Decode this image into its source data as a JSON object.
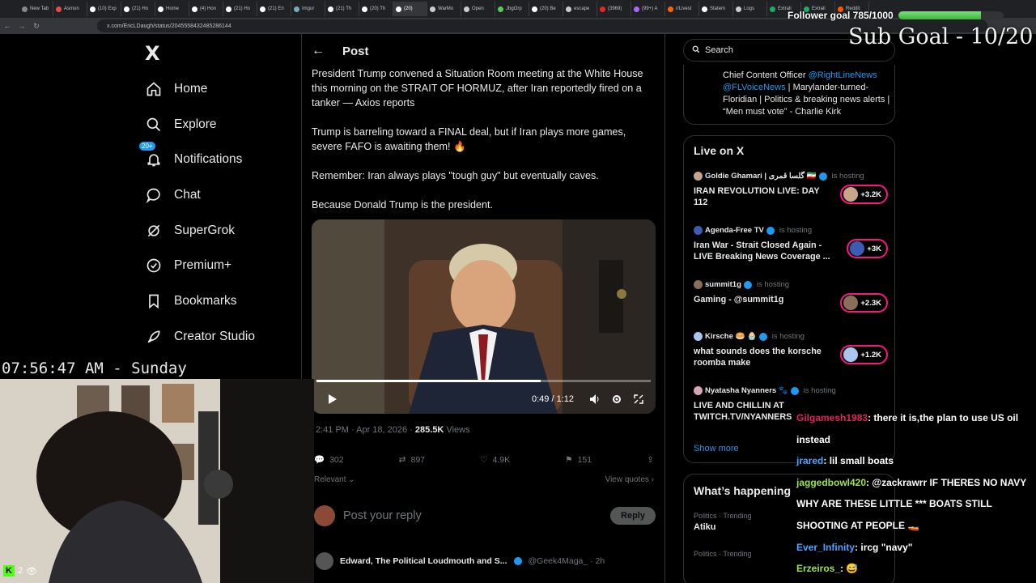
{
  "browser": {
    "tabs": [
      "New Tab",
      "Asmon",
      "(10) Exp",
      "(21) Ho",
      "Home",
      "(4) Hon",
      "(21) Ho",
      "(21) Eri",
      "Imgur",
      "(21) Th",
      "(20) Th",
      "(20)",
      "WarMo",
      "Open",
      "JbgOrp",
      "(20) Be",
      "escape",
      "(3969)",
      "(99+) A",
      "r/Livest",
      "Statem",
      "Logs",
      "Extrali",
      "Extrali",
      "Reddit"
    ],
    "active_tab_index": 11,
    "url": "x.com/EricLDaugh/status/2045558432485286144"
  },
  "nav": {
    "logo": "X",
    "items": [
      {
        "label": "Home",
        "icon": "home-icon"
      },
      {
        "label": "Explore",
        "icon": "search-icon"
      },
      {
        "label": "Notifications",
        "icon": "bell-icon",
        "badge": "20+"
      },
      {
        "label": "Chat",
        "icon": "chat-icon"
      },
      {
        "label": "SuperGrok",
        "icon": "grok-icon"
      },
      {
        "label": "Premium+",
        "icon": "premium-icon"
      },
      {
        "label": "Bookmarks",
        "icon": "bookmark-icon"
      },
      {
        "label": "Creator Studio",
        "icon": "rocket-icon"
      }
    ]
  },
  "post": {
    "header": "Post",
    "paragraphs": [
      "President Trump convened a Situation Room meeting at the White House this morning on the STRAIT OF HORMUZ, after Iran reportedly fired on a tanker — Axios reports",
      "Trump is barreling toward a FINAL deal, but if Iran plays more games, severe FAFO is awaiting them! 🔥",
      "Remember: Iran always plays \"tough guy\" but eventually caves.",
      "Because Donald Trump is the president."
    ],
    "video": {
      "time": "0:49 / 1:12",
      "progress": 0.67
    },
    "timestamp": "2:41 PM · Apr 18, 2026 · ",
    "views": "285.5K",
    "views_label": " Views",
    "stats": {
      "replies": "302",
      "reposts": "897",
      "likes": "4.9K",
      "bookmarks": "151"
    },
    "sort": "Relevant",
    "view_quotes": "View quotes",
    "reply_placeholder": "Post your reply",
    "reply_button": "Reply",
    "next_name": "Edward, The Political Loudmouth and S...",
    "next_handle": "@Geek4Maga_ · 2h"
  },
  "right": {
    "search_placeholder": "Search",
    "bio_prefix": "Chief Content Officer ",
    "bio_link1": "@RightLineNews",
    "bio_link2": "@FLVoiceNews",
    "bio_rest": " | Marylander-turned-Floridian | Politics & breaking news alerts | “Men must vote” - Charlie Kirk",
    "live_title": "Live on X",
    "live": [
      {
        "host": "Goldie Ghamari | گلسا قمری 🇮🇷",
        "title": "IRAN REVOLUTION LIVE: DAY 112",
        "listeners": "+3.2K"
      },
      {
        "host": "Agenda-Free TV",
        "title": "Iran War - Strait Closed Again - LIVE Breaking News Coverage ...",
        "listeners": "+3K"
      },
      {
        "host": "summit1g",
        "title": "Gaming - @summit1g",
        "listeners": "+2.3K"
      },
      {
        "host": "Kirsche 🥯 🧁",
        "title": "what sounds does the korsche roomba make",
        "listeners": "+1.2K"
      },
      {
        "host": "Nyatasha Nyanners 🐾",
        "title": "LIVE AND CHILLIN AT TWITCH.TV/NYANNERS",
        "listeners": ""
      }
    ],
    "is_hosting": "is hosting",
    "show_more": "Show more",
    "happening_title": "What’s happening",
    "trends": [
      {
        "category": "Politics · Trending",
        "topic": "Atiku"
      },
      {
        "category": "Politics · Trending",
        "topic": ""
      }
    ]
  },
  "overlay": {
    "follower_goal": "Follower goal 785/1000",
    "follower_progress": 0.785,
    "sub_goal": "Sub Goal - 10/20",
    "clock": "07:56:47 AM - Sunday",
    "viewers": "2",
    "chat": [
      {
        "user": "Gilgamesh1983",
        "color": "#e0245e",
        "text": "there it is,the plan to use US oil instead"
      },
      {
        "user": "jrared",
        "color": "#4ea3ff",
        "text": "lil small boats"
      },
      {
        "user": "jaggedbowl420",
        "color": "#9ce34a",
        "text": "@zackrawrr IF THERES NO NAVY WHY ARE THESE LITTLE *** BOATS STILL SHOOTING AT PEOPLE"
      },
      {
        "user": "Ever_Infinity",
        "color": "#4ea3ff",
        "text": "ircg \"navy\""
      },
      {
        "user": "Erzeiros_",
        "color": "#9ce34a",
        "text": ""
      }
    ]
  }
}
